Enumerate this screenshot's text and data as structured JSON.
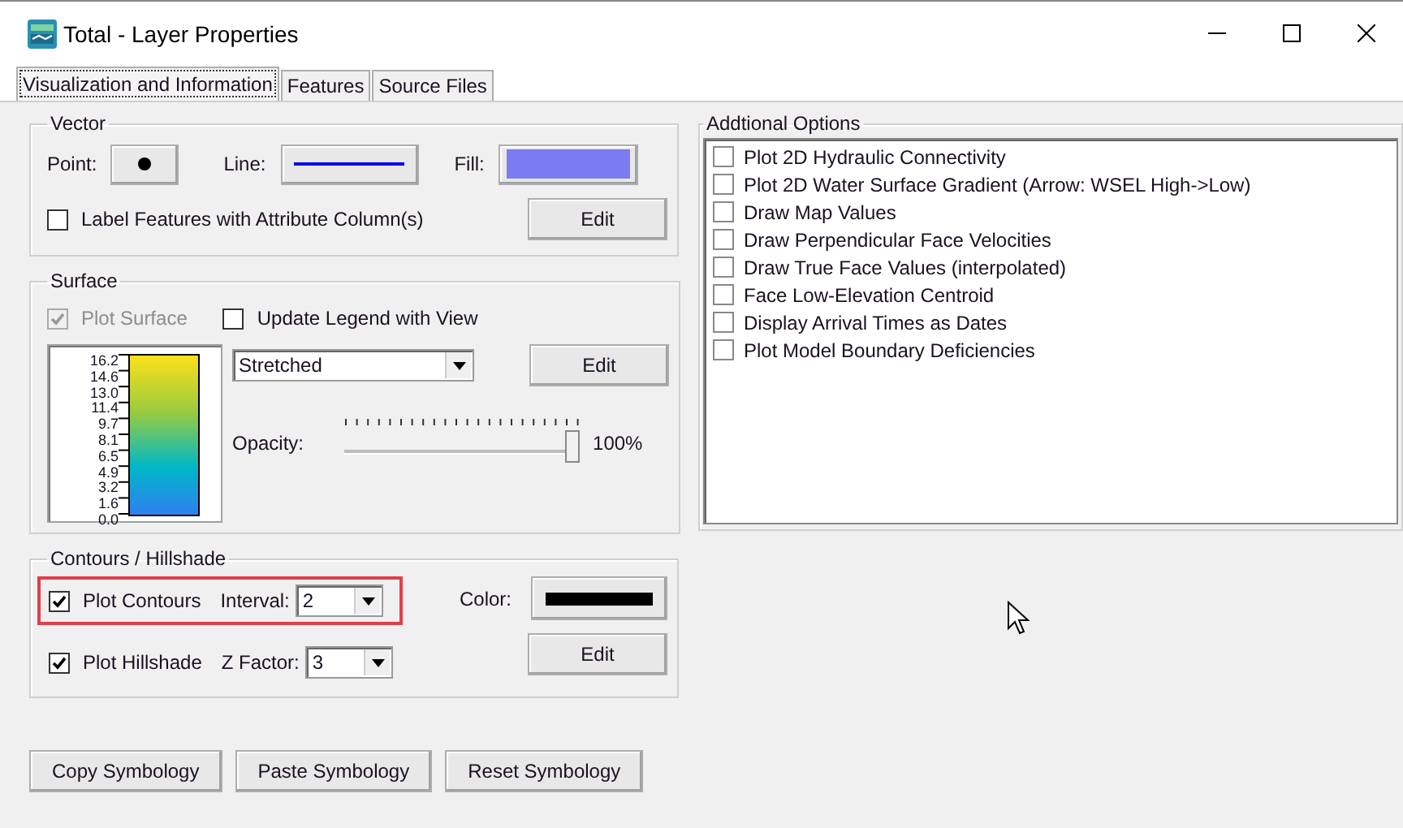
{
  "window": {
    "title": "Total - Layer Properties"
  },
  "tabs": [
    {
      "label": "Visualization and Information",
      "selected": true
    },
    {
      "label": "Features",
      "selected": false
    },
    {
      "label": "Source Files",
      "selected": false
    }
  ],
  "vector": {
    "title": "Vector",
    "point_label": "Point:",
    "line_label": "Line:",
    "fill_label": "Fill:",
    "label_features": {
      "label": "Label Features with Attribute Column(s)",
      "checked": false
    },
    "edit": "Edit"
  },
  "surface": {
    "title": "Surface",
    "plot_surface": {
      "label": "Plot Surface",
      "checked": true,
      "disabled": true
    },
    "update_legend": {
      "label": "Update Legend with View",
      "checked": false,
      "disabled": false
    },
    "legend_labels": [
      "16.2",
      "14.6",
      "13.0",
      "11.4",
      "9.7",
      "8.1",
      "6.5",
      "4.9",
      "3.2",
      "1.6",
      "0.0"
    ],
    "mode": "Stretched",
    "edit": "Edit",
    "opacity": {
      "label": "Opacity:",
      "level": 1,
      "reading": "100%"
    }
  },
  "contours": {
    "title": "Contours / Hillshade",
    "rows": [
      {
        "label": "Plot Contours",
        "checked": true,
        "highlighted": true,
        "field_label": "Interval:",
        "value": "2"
      },
      {
        "label": "Plot Hillshade",
        "checked": true,
        "highlighted": false,
        "field_label": "Z Factor:",
        "value": "3"
      }
    ],
    "color_label": "Color:",
    "edit": "Edit"
  },
  "additional_options": {
    "title": "Addtional Options",
    "items": [
      {
        "label": "Plot 2D Hydraulic Connectivity",
        "checked": false
      },
      {
        "label": "Plot 2D Water Surface Gradient (Arrow: WSEL High->Low)",
        "checked": false
      },
      {
        "label": "Draw Map Values",
        "checked": false
      },
      {
        "label": "Draw Perpendicular Face Velocities",
        "checked": false
      },
      {
        "label": "Draw True Face Values (interpolated)",
        "checked": false
      },
      {
        "label": "Face Low-Elevation Centroid",
        "checked": false
      },
      {
        "label": "Display Arrival Times as Dates",
        "checked": false
      },
      {
        "label": "Plot Model Boundary Deficiencies",
        "checked": false
      }
    ]
  },
  "buttons": [
    "Copy Symbology",
    "Paste Symbology",
    "Reset Symbology"
  ]
}
